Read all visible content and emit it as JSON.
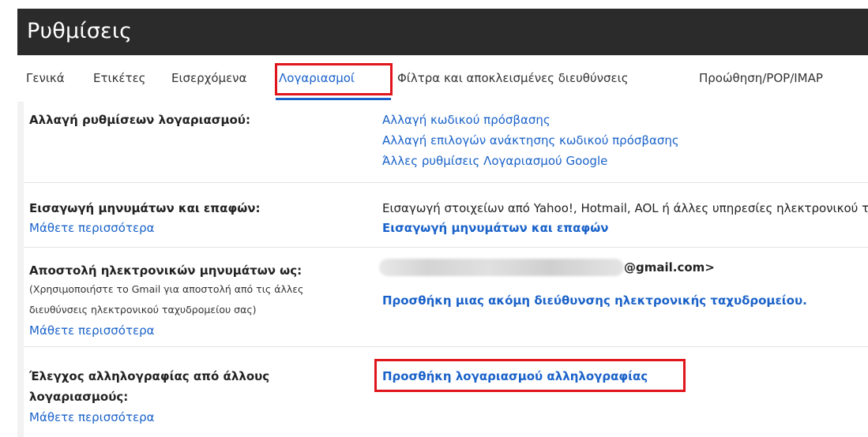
{
  "settings": {
    "title": "Ρυθμίσεις"
  },
  "tabs": [
    {
      "label": "Γενικά"
    },
    {
      "label": "Ετικέτες"
    },
    {
      "label": "Εισερχόμενα"
    },
    {
      "label": "Λογαριασμοί",
      "active": true
    },
    {
      "label": "Φίλτρα και αποκλεισμένες διευθύνσεις"
    },
    {
      "label": "Προώθηση/POP/IMAP"
    }
  ],
  "rows": {
    "change_account": {
      "label": "Αλλαγή ρυθμίσεων λογαριασμού:",
      "links": [
        "Αλλαγή κωδικού πρόσβασης",
        "Αλλαγή επιλογών ανάκτησης κωδικού πρόσβασης",
        "Άλλες ρυθμίσεις Λογαριασμού Google"
      ]
    },
    "import": {
      "label": "Εισαγωγή μηνυμάτων και επαφών:",
      "learn_more": "Μάθετε περισσότερα",
      "description": "Εισαγωγή στοιχείων από Yahoo!, Hotmail, AOL ή άλλες υπηρεσίες ηλεκτρονικού ταχυδρομείου",
      "action": "Εισαγωγή μηνυμάτων και επαφών"
    },
    "send_as": {
      "label": "Αποστολή ηλεκτρονικών μηνυμάτων ως:",
      "note_line1": "(Χρησιμοποιήστε το Gmail για αποστολή από τις άλλες",
      "note_line2": "διευθύνσεις ηλεκτρονικού ταχυδρομείου σας)",
      "learn_more": "Μάθετε περισσότερα",
      "email_suffix": "@gmail.com>",
      "action": "Προσθήκη μιας ακόμη διεύθυνσης ηλεκτρονικής ταχυδρομείου."
    },
    "check_mail": {
      "label_line1": "Έλεγχος αλληλογραφίας από άλλους",
      "label_line2": "λογαριασμούς:",
      "learn_more": "Μάθετε περισσότερα",
      "action": "Προσθήκη λογαριασμού αλληλογραφίας"
    }
  },
  "colors": {
    "accent": "#1a62c9",
    "highlight": "#e0151b",
    "titlebar": "#2b2b2b"
  }
}
